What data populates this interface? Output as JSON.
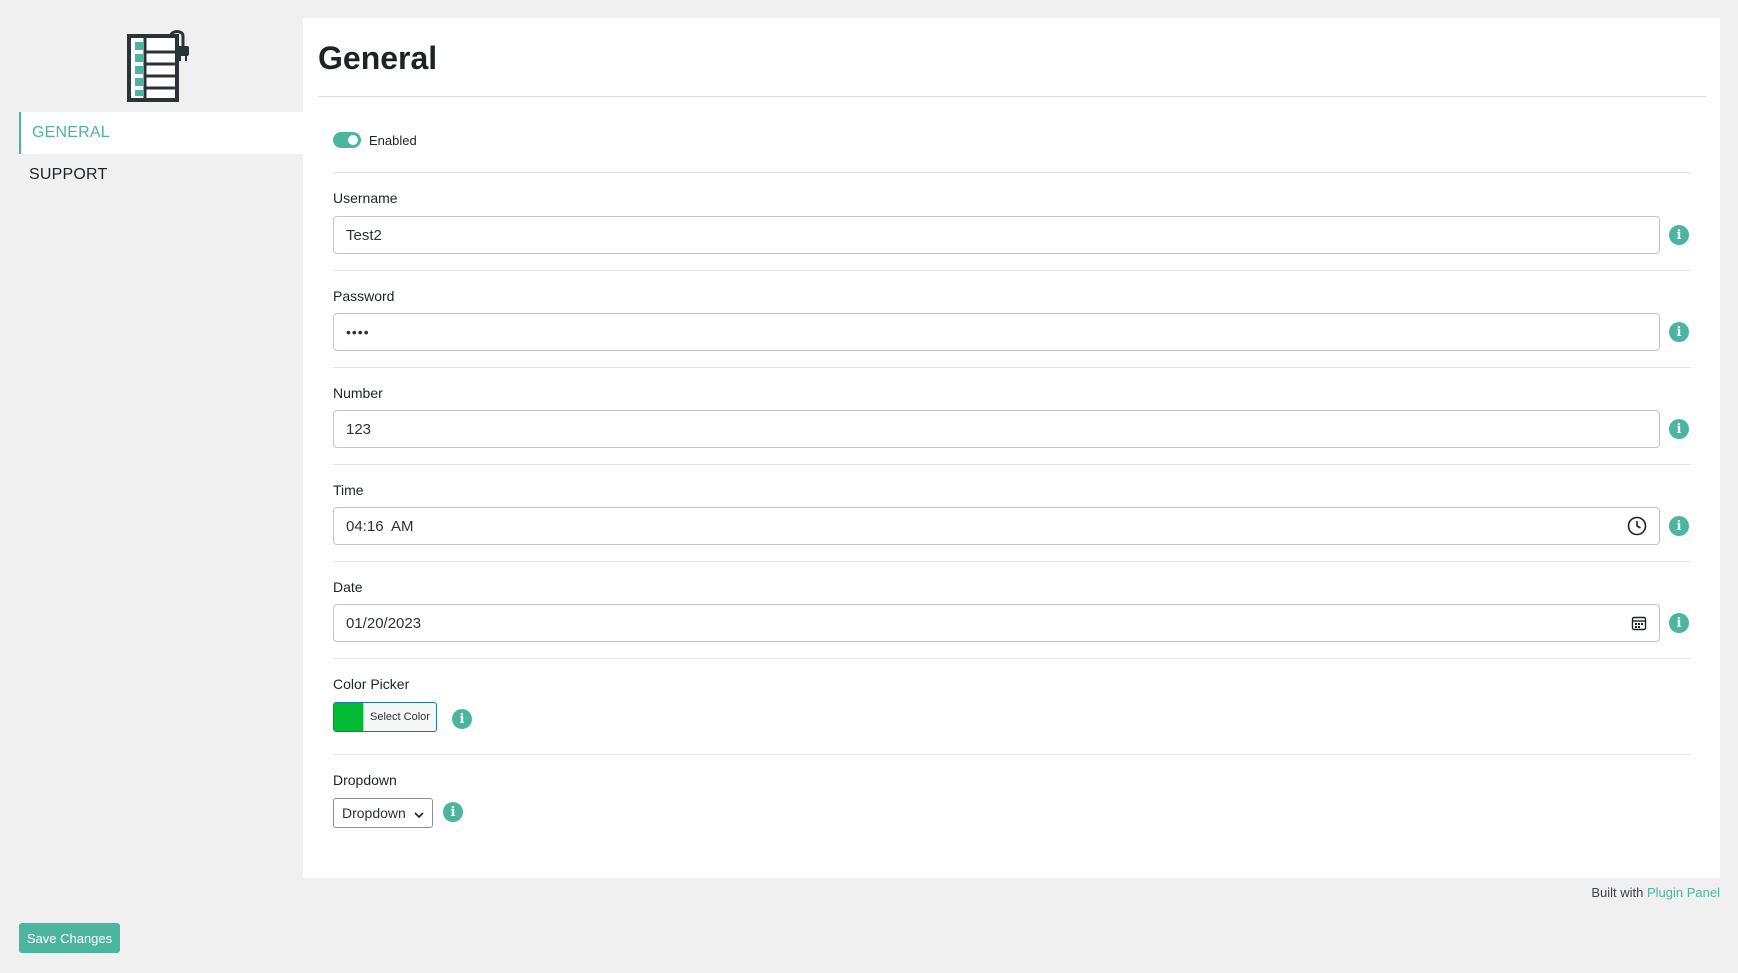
{
  "sidebar": {
    "logo_icon": "plugin-panel-logo-icon",
    "items": [
      {
        "label": "GENERAL",
        "active": true
      },
      {
        "label": "SUPPORT",
        "active": false
      }
    ]
  },
  "panel": {
    "title": "General",
    "toggle": {
      "label": "Enabled",
      "on": true
    },
    "fields": {
      "username": {
        "label": "Username",
        "value": "Test2"
      },
      "password": {
        "label": "Password",
        "value": "••••"
      },
      "number": {
        "label": "Number",
        "value": "123"
      },
      "time": {
        "label": "Time",
        "value": "04:16  AM",
        "icon": "clock-icon"
      },
      "date": {
        "label": "Date",
        "value": "01/20/2023",
        "icon": "calendar-icon"
      },
      "color": {
        "label": "Color Picker",
        "button": "Select Color",
        "swatch": "#00bb33"
      },
      "dropdown": {
        "label": "Dropdown",
        "selected": "Dropdown"
      }
    },
    "info_icon": "info-icon"
  },
  "footer": {
    "prefix": "Built with ",
    "link": "Plugin Panel"
  },
  "save_label": "Save Changes",
  "colors": {
    "accent": "#4cb5a0",
    "background": "#f0f0f1",
    "panel": "#ffffff"
  }
}
